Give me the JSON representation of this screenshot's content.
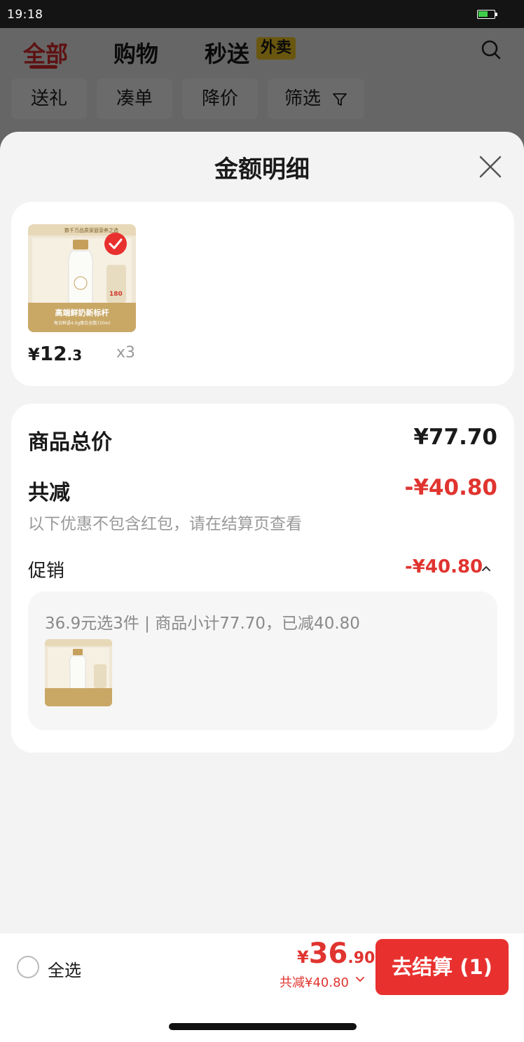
{
  "status_bar": {
    "time": "19:18",
    "battery_color": "#3ecf4a"
  },
  "background": {
    "tabs": [
      {
        "label": "全部",
        "active": true
      },
      {
        "label": "购物",
        "active": false
      },
      {
        "label": "秒送",
        "active": false
      }
    ],
    "express_badge": "外卖",
    "filters": [
      "送礼",
      "凑单",
      "降价",
      "筛选"
    ]
  },
  "sheet": {
    "title": "金额明细",
    "products": [
      {
        "price_symbol": "¥",
        "price_int": "12",
        "price_dec": ".3",
        "quantity": "x3",
        "selected": true,
        "image_caption_top": "数千万品质家庭营养之选",
        "image_caption_main": "高端鲜奶新标杆",
        "image_caption_sub": "每日鲜语4.0g蛋白全脂720ml",
        "image_badge": "180"
      }
    ],
    "summary": {
      "total_label": "商品总价",
      "total_value": "¥77.70",
      "reduce_label": "共减",
      "reduce_value": "-¥40.80",
      "note": "以下优惠不包含红包，请在结算页查看",
      "promo_label": "促销",
      "promo_value": "-¥40.80",
      "promo_desc": "36.9元选3件 | 商品小计77.70，已减40.80"
    }
  },
  "bottom_bar": {
    "select_all": "全选",
    "price_symbol": "¥",
    "price_int": "36",
    "price_dec": ".90",
    "reduce_text": "共减¥40.80",
    "checkout_label": "去结算 (1)"
  },
  "colors": {
    "accent_red": "#e0342f",
    "badge_yellow": "#f9cf27"
  }
}
